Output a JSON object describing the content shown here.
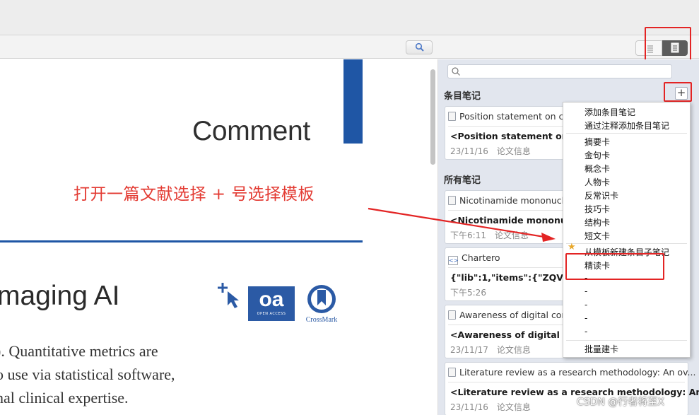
{
  "document": {
    "heading": "Comment",
    "instruction": "打开一篇文献选择 + 号选择模板",
    "article_title_fragment": "maging AI",
    "oa_badge": "oa",
    "oa_sub": "OPEN ACCESS",
    "crossmark_label": "CrossMark",
    "body_lines": [
      "). Quantitative metrics are",
      "o use via statistical software,",
      "nal clinical expertise."
    ]
  },
  "panel": {
    "item_notes_title": "条目笔记",
    "all_notes_title": "所有笔记",
    "add_button": "+"
  },
  "cards": [
    {
      "title": "Position statement on cl",
      "body": "<Position statement on cli",
      "date": "23/11/16",
      "tag": "论文信息"
    },
    {
      "title": "Nicotinamide mononucl",
      "body": "<Nicotinamide mononucle",
      "date": "下午6:11",
      "tag": "论文信息"
    },
    {
      "title": "Chartero",
      "body": "{\"lib\":1,\"items\":{\"ZQVUIET",
      "date": "下午5:26",
      "tag": ""
    },
    {
      "title": "Awareness of digital con",
      "body": "<Awareness of digital com",
      "date": "23/11/17",
      "tag": "论文信息"
    },
    {
      "title": "Literature review as a research methodology: An ov...",
      "body": "<Literature review as a research methodology: An o...",
      "date": "23/11/16",
      "tag": "论文信息"
    }
  ],
  "menu": {
    "items": [
      "添加条目笔记",
      "通过注释添加条目笔记",
      "摘要卡",
      "金句卡",
      "概念卡",
      "人物卡",
      "反常识卡",
      "技巧卡",
      "结构卡",
      "短文卡",
      "从模板新建条目子笔记",
      "精读卡",
      "-",
      "-",
      "-",
      "-",
      "-",
      "批量建卡"
    ]
  },
  "watermark": "CSDN @行者将至X",
  "colors": {
    "accent_blue": "#1f56a5",
    "instruction_red": "#e33b33",
    "highlight_red": "#e32424",
    "panel_bg": "#e2e6ee"
  }
}
